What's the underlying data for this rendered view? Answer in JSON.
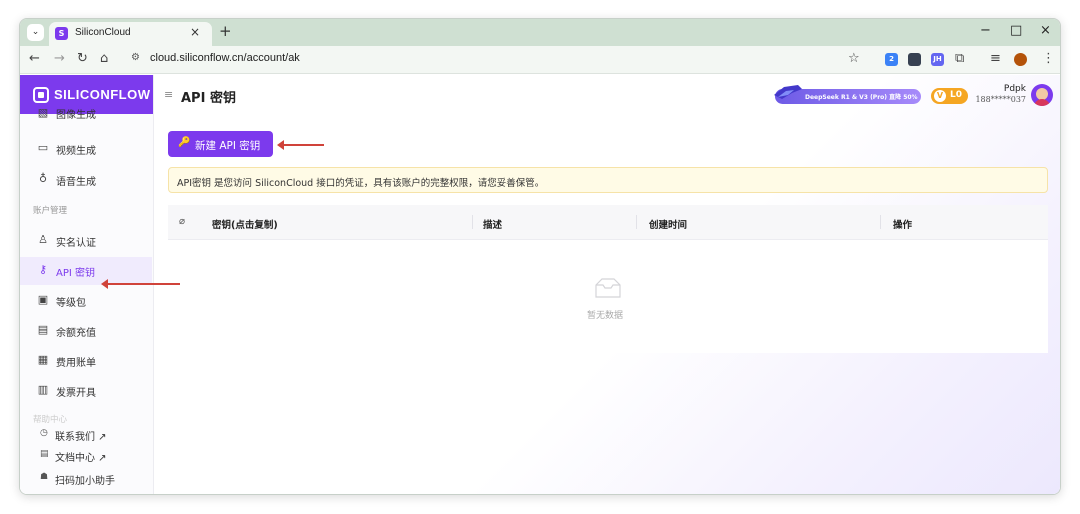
{
  "browser": {
    "tab_title": "SiliconCloud",
    "tab_close": "×",
    "new_tab": "+",
    "url": "cloud.siliconflow.cn/account/ak",
    "window_controls": {
      "minimize": "−",
      "maximize": "□",
      "close": "×"
    },
    "extension_badge": "2",
    "extension_label": "JH"
  },
  "sidebar": {
    "logo_text": "SILICONFLOW",
    "items_top": [
      {
        "label": "图像生成",
        "icon": "image-icon"
      },
      {
        "label": "视频生成",
        "icon": "video-icon"
      },
      {
        "label": "语音生成",
        "icon": "microphone-icon"
      }
    ],
    "section_account": "账户管理",
    "items_account": [
      {
        "label": "实名认证",
        "icon": "user-verify-icon"
      },
      {
        "label": "API 密钥",
        "icon": "key-icon",
        "active": true
      },
      {
        "label": "等级包",
        "icon": "package-icon"
      },
      {
        "label": "余额充值",
        "icon": "wallet-icon"
      },
      {
        "label": "费用账单",
        "icon": "bill-icon"
      },
      {
        "label": "发票开具",
        "icon": "invoice-icon"
      }
    ],
    "section_help": "帮助中心",
    "links": [
      {
        "label": "联系我们 ↗",
        "icon": "help-circle-icon"
      },
      {
        "label": "文档中心 ↗",
        "icon": "document-icon"
      },
      {
        "label": "扫码加小助手",
        "icon": "people-icon"
      }
    ]
  },
  "header": {
    "title": "API 密钥",
    "promo": "DeepSeek R1 & V3 (Pro) 直降 50%",
    "level": "L0",
    "user_name": "Pdpk",
    "user_phone": "188*****037"
  },
  "main": {
    "new_key_button": "新建 API 密钥",
    "notice": "API密钥 是您访问 SiliconCloud 接口的凭证，具有该账户的完整权限，请您妥善保管。",
    "table": {
      "columns": [
        "密钥(点击复制)",
        "描述",
        "创建时间",
        "操作"
      ],
      "rows": [],
      "empty_text": "暂无数据"
    }
  },
  "colors": {
    "accent": "#7c3aed",
    "annotation_arrow": "#d0433a",
    "notice_bg": "#fffbe6"
  }
}
